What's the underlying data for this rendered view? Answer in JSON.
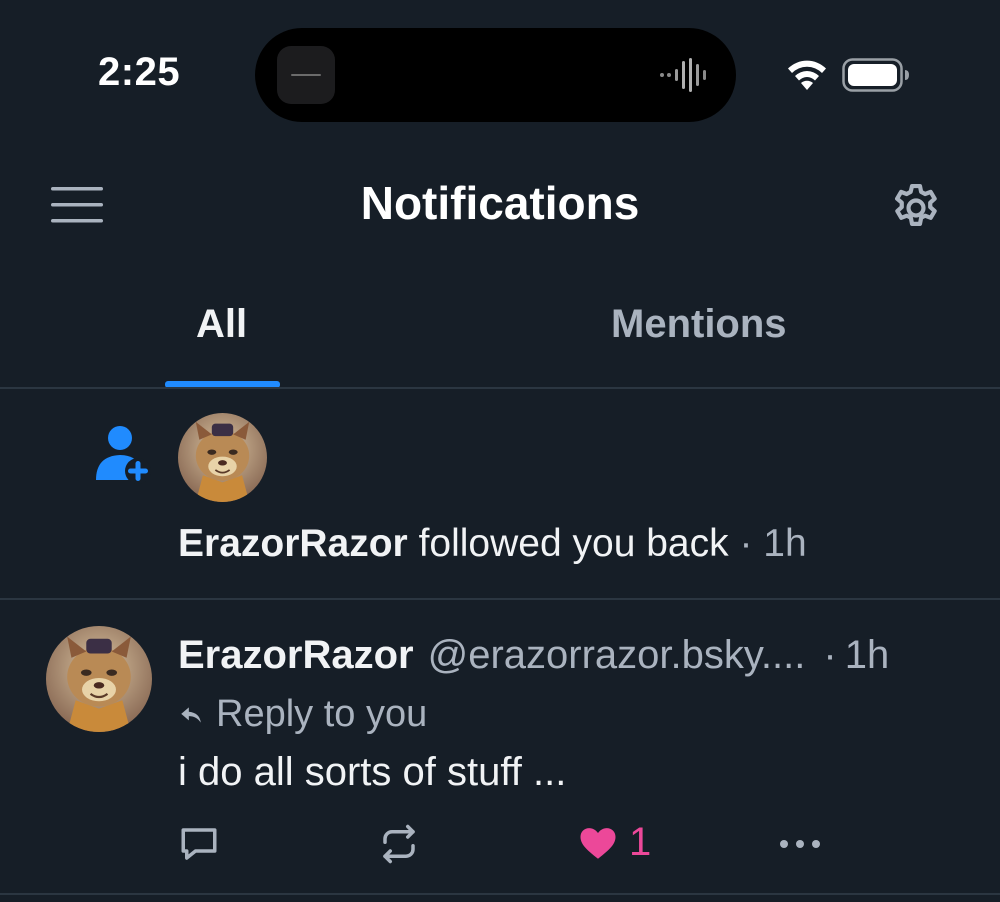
{
  "status_bar": {
    "time": "2:25"
  },
  "header": {
    "title": "Notifications",
    "menu_icon": "hamburger-menu-icon",
    "settings_icon": "gear-icon"
  },
  "tabs": [
    {
      "label": "All",
      "selected": true
    },
    {
      "label": "Mentions",
      "selected": false
    }
  ],
  "colors": {
    "background": "#161e27",
    "accent": "#208bfe",
    "like": "#ec4899",
    "muted": "#aab3bf",
    "divider": "#2b3641"
  },
  "notifications": [
    {
      "type": "follow",
      "icon": "person-add-icon",
      "user": "ErazorRazor",
      "action_text": "followed you back",
      "separator": "·",
      "time": "1h"
    },
    {
      "type": "reply",
      "user": "ErazorRazor",
      "handle": "@erazorrazor.bsky....",
      "separator": "·",
      "time": "1h",
      "reply_label": "Reply to you",
      "text": "i do all sorts of stuff ...",
      "like_count": "1",
      "liked": true
    }
  ]
}
